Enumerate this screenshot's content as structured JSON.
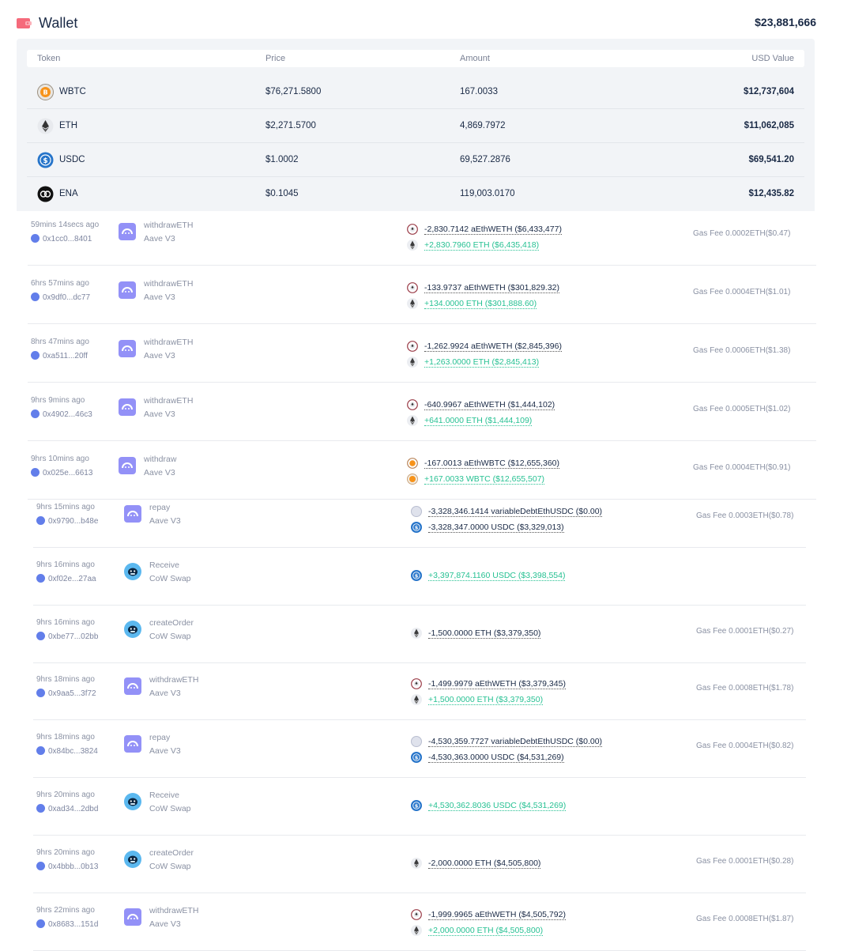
{
  "wallet": {
    "title": "Wallet",
    "total": "$23,881,666",
    "icon": "wallet-icon",
    "accent": "#f56a7b"
  },
  "token_table": {
    "headers": {
      "token": "Token",
      "price": "Price",
      "amount": "Amount",
      "usd": "USD Value"
    },
    "rows": [
      {
        "icon": "wbtc-icon",
        "symbol": "WBTC",
        "price": "$76,271.5800",
        "amount": "167.0033",
        "usd": "$12,737,604"
      },
      {
        "icon": "eth-icon",
        "symbol": "ETH",
        "price": "$2,271.5700",
        "amount": "4,869.7972",
        "usd": "$11,062,085"
      },
      {
        "icon": "usdc-icon",
        "symbol": "USDC",
        "price": "$1.0002",
        "amount": "69,527.2876",
        "usd": "$69,541.20"
      },
      {
        "icon": "ena-icon",
        "symbol": "ENA",
        "price": "$0.1045",
        "amount": "119,003.0170",
        "usd": "$12,435.82"
      }
    ]
  },
  "colors": {
    "positive": "#27c193",
    "negative": "#192945",
    "muted": "#8a91a3",
    "aave": "#9391f7",
    "cow": "#5bb8ef"
  },
  "transactions": [
    {
      "time": "59mins 14secs ago",
      "hash": "0x1cc0...8401",
      "method": "withdrawETH",
      "protocol": "Aave V3",
      "protocol_icon": "aave-icon",
      "changes": [
        {
          "icon": "aethweth-icon",
          "text": "-2,830.7142 aEthWETH ($6,433,477)",
          "dir": "neg"
        },
        {
          "icon": "eth-icon",
          "text": "+2,830.7960 ETH ($6,435,418)",
          "dir": "pos"
        }
      ],
      "gas": "Gas Fee  0.0002ETH($0.47)"
    },
    {
      "time": "6hrs 57mins ago",
      "hash": "0x9df0...dc77",
      "method": "withdrawETH",
      "protocol": "Aave V3",
      "protocol_icon": "aave-icon",
      "changes": [
        {
          "icon": "aethweth-icon",
          "text": "-133.9737 aEthWETH ($301,829.32)",
          "dir": "neg"
        },
        {
          "icon": "eth-icon",
          "text": "+134.0000 ETH ($301,888.60)",
          "dir": "pos"
        }
      ],
      "gas": "Gas Fee  0.0004ETH($1.01)"
    },
    {
      "time": "8hrs 47mins ago",
      "hash": "0xa511...20ff",
      "method": "withdrawETH",
      "protocol": "Aave V3",
      "protocol_icon": "aave-icon",
      "changes": [
        {
          "icon": "aethweth-icon",
          "text": "-1,262.9924 aEthWETH ($2,845,396)",
          "dir": "neg"
        },
        {
          "icon": "eth-icon",
          "text": "+1,263.0000 ETH ($2,845,413)",
          "dir": "pos"
        }
      ],
      "gas": "Gas Fee  0.0006ETH($1.38)"
    },
    {
      "time": "9hrs 9mins ago",
      "hash": "0x4902...46c3",
      "method": "withdrawETH",
      "protocol": "Aave V3",
      "protocol_icon": "aave-icon",
      "changes": [
        {
          "icon": "aethweth-icon",
          "text": "-640.9967 aEthWETH ($1,444,102)",
          "dir": "neg"
        },
        {
          "icon": "eth-icon",
          "text": "+641.0000 ETH ($1,444,109)",
          "dir": "pos"
        }
      ],
      "gas": "Gas Fee  0.0005ETH($1.02)"
    },
    {
      "time": "9hrs 10mins ago",
      "hash": "0x025e...6613",
      "method": "withdraw",
      "protocol": "Aave V3",
      "protocol_icon": "aave-icon",
      "changes": [
        {
          "icon": "aethwbtc-icon",
          "text": "-167.0013 aEthWBTC ($12,655,360)",
          "dir": "neg"
        },
        {
          "icon": "wbtc-icon",
          "text": "+167.0033 WBTC ($12,655,507)",
          "dir": "pos"
        }
      ],
      "gas": "Gas Fee  0.0004ETH($0.91)"
    },
    {
      "time": "9hrs 15mins ago",
      "hash": "0x9790...b48e",
      "method": "repay",
      "protocol": "Aave V3",
      "protocol_icon": "aave-icon",
      "changes": [
        {
          "icon": "variabledebt-icon",
          "text": "-3,328,346.1414 variableDebtEthUSDC ($0.00)",
          "dir": "neg"
        },
        {
          "icon": "usdc-icon",
          "text": "-3,328,347.0000 USDC ($3,329,013)",
          "dir": "neg"
        }
      ],
      "gas": "Gas Fee  0.0003ETH($0.78)"
    },
    {
      "time": "9hrs 16mins ago",
      "hash": "0xf02e...27aa",
      "method": "Receive",
      "protocol": "CoW Swap",
      "protocol_icon": "cowswap-icon",
      "changes": [
        {
          "icon": "usdc-icon",
          "text": "+3,397,874.1160 USDC ($3,398,554)",
          "dir": "pos"
        }
      ],
      "gas": ""
    },
    {
      "time": "9hrs 16mins ago",
      "hash": "0xbe77...02bb",
      "method": "createOrder",
      "protocol": "CoW Swap",
      "protocol_icon": "cowswap-icon",
      "changes": [
        {
          "icon": "eth-icon",
          "text": "-1,500.0000 ETH ($3,379,350)",
          "dir": "neg"
        }
      ],
      "gas": "Gas Fee  0.0001ETH($0.27)"
    },
    {
      "time": "9hrs 18mins ago",
      "hash": "0x9aa5...3f72",
      "method": "withdrawETH",
      "protocol": "Aave V3",
      "protocol_icon": "aave-icon",
      "changes": [
        {
          "icon": "aethweth-icon",
          "text": "-1,499.9979 aEthWETH ($3,379,345)",
          "dir": "neg"
        },
        {
          "icon": "eth-icon",
          "text": "+1,500.0000 ETH ($3,379,350)",
          "dir": "pos"
        }
      ],
      "gas": "Gas Fee  0.0008ETH($1.78)"
    },
    {
      "time": "9hrs 18mins ago",
      "hash": "0x84bc...3824",
      "method": "repay",
      "protocol": "Aave V3",
      "protocol_icon": "aave-icon",
      "changes": [
        {
          "icon": "variabledebt-icon",
          "text": "-4,530,359.7727 variableDebtEthUSDC ($0.00)",
          "dir": "neg"
        },
        {
          "icon": "usdc-icon",
          "text": "-4,530,363.0000 USDC ($4,531,269)",
          "dir": "neg"
        }
      ],
      "gas": "Gas Fee  0.0004ETH($0.82)"
    },
    {
      "time": "9hrs 20mins ago",
      "hash": "0xad34...2dbd",
      "method": "Receive",
      "protocol": "CoW Swap",
      "protocol_icon": "cowswap-icon",
      "changes": [
        {
          "icon": "usdc-icon",
          "text": "+4,530,362.8036 USDC ($4,531,269)",
          "dir": "pos"
        }
      ],
      "gas": ""
    },
    {
      "time": "9hrs 20mins ago",
      "hash": "0x4bbb...0b13",
      "method": "createOrder",
      "protocol": "CoW Swap",
      "protocol_icon": "cowswap-icon",
      "changes": [
        {
          "icon": "eth-icon",
          "text": "-2,000.0000 ETH ($4,505,800)",
          "dir": "neg"
        }
      ],
      "gas": "Gas Fee  0.0001ETH($0.28)"
    },
    {
      "time": "9hrs 22mins ago",
      "hash": "0x8683...151d",
      "method": "withdrawETH",
      "protocol": "Aave V3",
      "protocol_icon": "aave-icon",
      "changes": [
        {
          "icon": "aethweth-icon",
          "text": "-1,999.9965 aEthWETH ($4,505,792)",
          "dir": "neg"
        },
        {
          "icon": "eth-icon",
          "text": "+2,000.0000 ETH ($4,505,800)",
          "dir": "pos"
        }
      ],
      "gas": "Gas Fee  0.0008ETH($1.87)"
    }
  ]
}
